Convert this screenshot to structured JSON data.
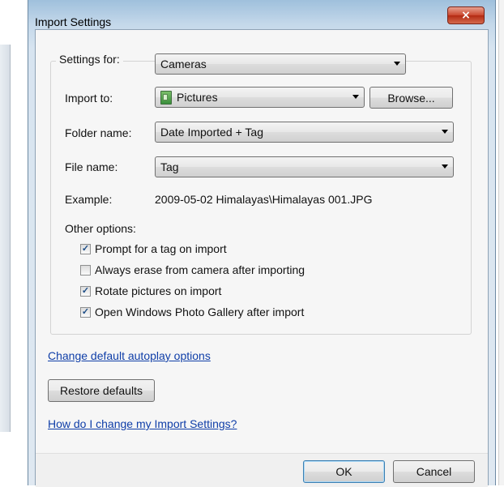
{
  "window": {
    "title": "Import Settings",
    "close_glyph": "×"
  },
  "settings_for": {
    "label": "Settings for:",
    "value": "Cameras"
  },
  "import_to": {
    "label": "Import to:",
    "value": "Pictures",
    "icon": "pictures-folder-icon",
    "browse_label": "Browse..."
  },
  "folder_name": {
    "label": "Folder name:",
    "value": "Date Imported + Tag"
  },
  "file_name": {
    "label": "File name:",
    "value": "Tag"
  },
  "example": {
    "label": "Example:",
    "value": "2009-05-02 Himalayas\\Himalayas 001.JPG"
  },
  "other_options": {
    "label": "Other options:",
    "items": [
      {
        "label": "Prompt for a tag on import",
        "checked": true
      },
      {
        "label": "Always erase from camera after importing",
        "checked": false
      },
      {
        "label": "Rotate pictures on import",
        "checked": true
      },
      {
        "label": "Open Windows Photo Gallery after import",
        "checked": true
      }
    ]
  },
  "links": {
    "autoplay": "Change default autoplay options",
    "help": "How do I change my Import Settings?"
  },
  "buttons": {
    "restore": "Restore defaults",
    "ok": "OK",
    "cancel": "Cancel"
  },
  "colors": {
    "link": "#0f3ea8",
    "close_button": "#c9472e",
    "check": "#1c4d86"
  }
}
